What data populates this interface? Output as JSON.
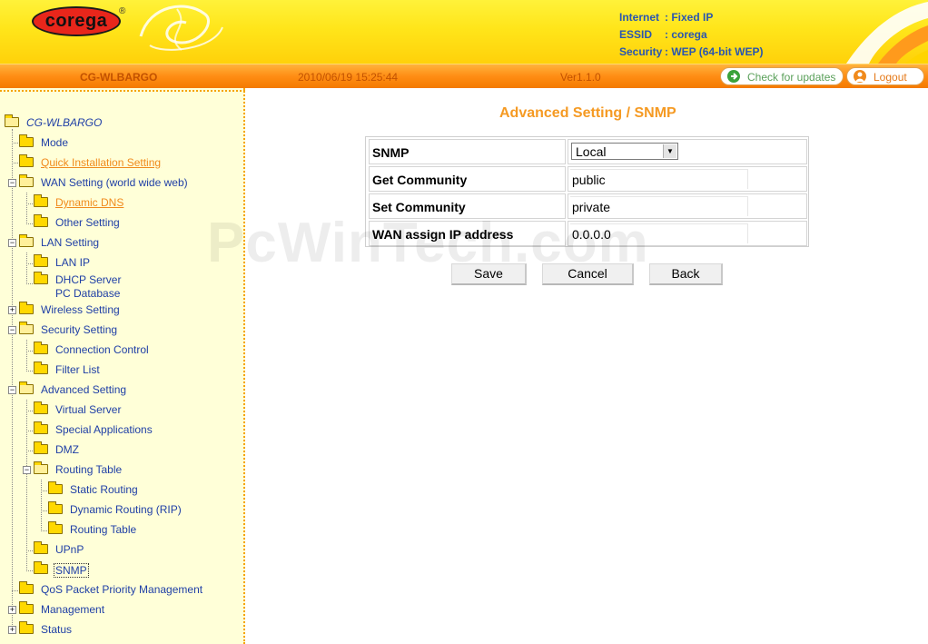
{
  "header": {
    "logo_text": "corega",
    "logo_reg": "®",
    "info": [
      {
        "label": "Internet",
        "value": ": Fixed IP"
      },
      {
        "label": "ESSID",
        "value": ": corega"
      },
      {
        "label": "Security",
        "value": ": WEP (64-bit WEP)"
      }
    ]
  },
  "topbar": {
    "model": "CG-WLBARGO",
    "datetime": "2010/06/19 15:25:44",
    "version": "Ver1.1.0",
    "check_updates_label": "Check for updates",
    "check_updates_icon": "refresh-icon",
    "logout_label": "Logout",
    "logout_icon": "user-icon"
  },
  "sidebar": {
    "root": "CG-WLBARGO",
    "items": [
      {
        "label": "Mode"
      },
      {
        "label": "Quick Installation Setting"
      },
      {
        "label": "WAN Setting (world wide web)"
      },
      {
        "label": "Dynamic DNS"
      },
      {
        "label": "Other Setting"
      },
      {
        "label": "LAN Setting"
      },
      {
        "label": "LAN IP"
      },
      {
        "label": "DHCP Server",
        "label2": "PC Database"
      },
      {
        "label": "Wireless Setting"
      },
      {
        "label": "Security Setting"
      },
      {
        "label": "Connection Control"
      },
      {
        "label": "Filter List"
      },
      {
        "label": "Advanced Setting"
      },
      {
        "label": "Virtual Server"
      },
      {
        "label": "Special Applications"
      },
      {
        "label": "DMZ"
      },
      {
        "label": "Routing Table"
      },
      {
        "label": "Static Routing"
      },
      {
        "label": "Dynamic Routing (RIP)"
      },
      {
        "label": "Routing Table"
      },
      {
        "label": "UPnP"
      },
      {
        "label": "SNMP"
      },
      {
        "label": "QoS Packet Priority Management"
      },
      {
        "label": "Management"
      },
      {
        "label": "Status"
      }
    ]
  },
  "main": {
    "title": "Advanced Setting / SNMP",
    "snmp_label": "SNMP",
    "snmp_value": "Local",
    "get_community_label": "Get Community",
    "get_community_value": "public",
    "set_community_label": "Set Community",
    "set_community_value": "private",
    "wan_ip_label": "WAN assign IP address",
    "wan_ip_value": "0.0.0.0",
    "save_label": "Save",
    "cancel_label": "Cancel",
    "back_label": "Back"
  },
  "watermark": "PcWinTech.com",
  "colors": {
    "accent_orange": "#f59a23",
    "link_blue": "#1f3fa6",
    "header_yellow": "#ffe51a",
    "bar_orange": "#ff8d14"
  }
}
